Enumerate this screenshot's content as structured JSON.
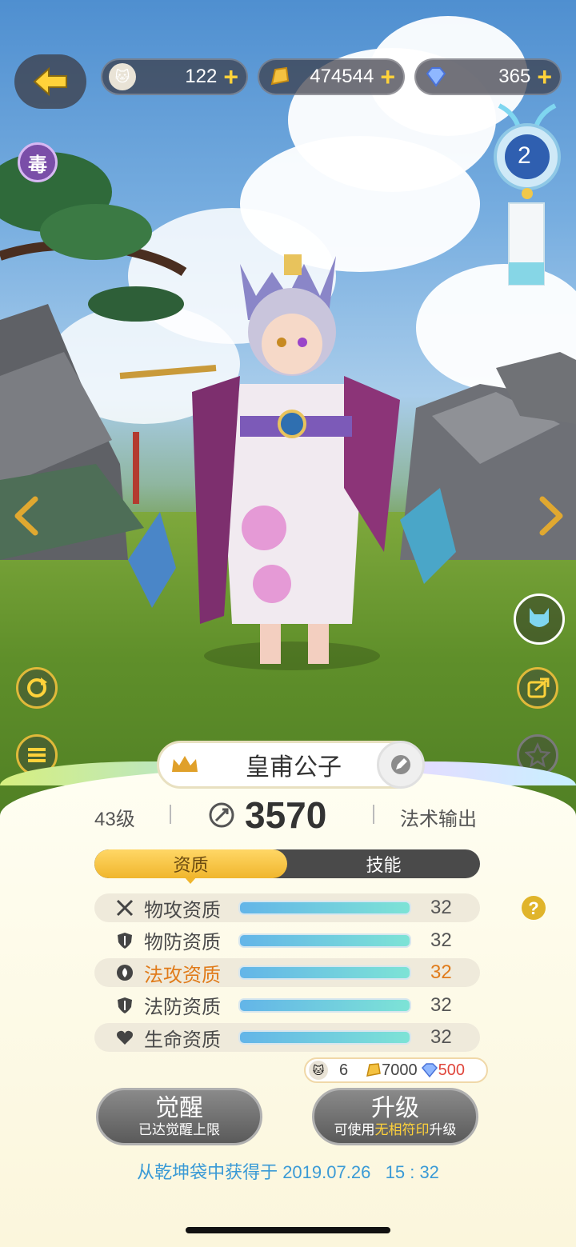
{
  "currency": {
    "pet_tokens": "122",
    "gold": "474544",
    "diamonds": "365"
  },
  "badge": {
    "poison": "毒"
  },
  "wind_chime": {
    "level": "2"
  },
  "character": {
    "name": "皇甫公子",
    "level": "43级",
    "power": "3570",
    "role": "法术输出"
  },
  "tabs": [
    "资质",
    "技能"
  ],
  "attributes": [
    {
      "label": "物攻资质",
      "value": "32",
      "icon": "crossed-swords-icon"
    },
    {
      "label": "物防资质",
      "value": "32",
      "icon": "shield-icon"
    },
    {
      "label": "法攻资质",
      "value": "32",
      "icon": "magic-swirl-icon"
    },
    {
      "label": "法防资质",
      "value": "32",
      "icon": "shield-icon"
    },
    {
      "label": "生命资质",
      "value": "32",
      "icon": "heart-icon"
    }
  ],
  "attribute_fill": 1.0,
  "highlight_color": "#e07b1a",
  "cost": {
    "tokens": "6",
    "gold": "7000",
    "diamonds": "500"
  },
  "awaken_button": {
    "title": "觉醒",
    "subtitle": "已达觉醒上限"
  },
  "upgrade_button": {
    "title": "升级",
    "subtitle_prefix": "可使用",
    "subtitle_highlight": "无相符印",
    "subtitle_suffix": "升级"
  },
  "acquired": "从乾坤袋中获得于 2019.07.26   15 : 32"
}
